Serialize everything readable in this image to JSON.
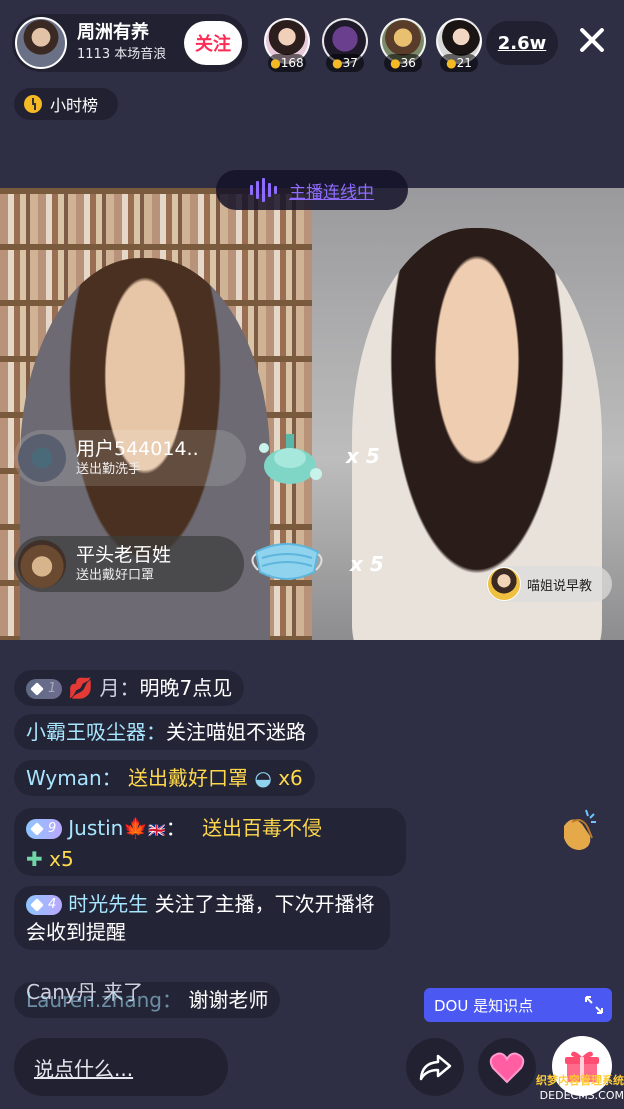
{
  "host": {
    "name": "周洲有养",
    "stats": "1113 本场音浪",
    "follow_label": "关注"
  },
  "top_viewers": [
    {
      "score": "168"
    },
    {
      "score": "37"
    },
    {
      "score": "36"
    },
    {
      "score": "21"
    }
  ],
  "viewer_count": "2.6w",
  "hourly_rank_label": "小时榜",
  "link_status": "主播连线中",
  "gift_notifications": [
    {
      "user": "用户544014..",
      "action": "送出勤洗手",
      "multiplier": "x 5"
    },
    {
      "user": "平头老百姓",
      "action": "送出戴好口罩",
      "multiplier": "x 5"
    }
  ],
  "guest_tag": "喵姐说早教",
  "chat": [
    {
      "badge": "1",
      "user": "月：",
      "message": "明晚7点见"
    },
    {
      "user": "小霸王吸尘器：",
      "message": "关注喵姐不迷路"
    },
    {
      "user": "Wyman：",
      "message": "送出戴好口罩",
      "count": "x6"
    },
    {
      "badge": "9",
      "user": "Justin",
      "message": "送出百毒不侵",
      "count": "x5"
    },
    {
      "badge": "4",
      "user": "时光先生",
      "message": "关注了主播，下次开播将会收到提醒"
    },
    {
      "user": "Cany丹 来了",
      "user_overlap": "Lauren.zhang：",
      "message": "谢谢老师"
    }
  ],
  "dou_label": "DOU 是知识点",
  "comment_placeholder": "说点什么...",
  "watermark": {
    "top": "织梦内容管理系统",
    "bottom": "DEDECMS.COM"
  },
  "colors": {
    "background": "#2e2f45",
    "follow_text": "#fe2c55",
    "link_purple": "#8f6bff",
    "dou_blue": "#4b59f2",
    "chat_username": "#a8e6ff",
    "gift_gold": "#ffd84d"
  }
}
